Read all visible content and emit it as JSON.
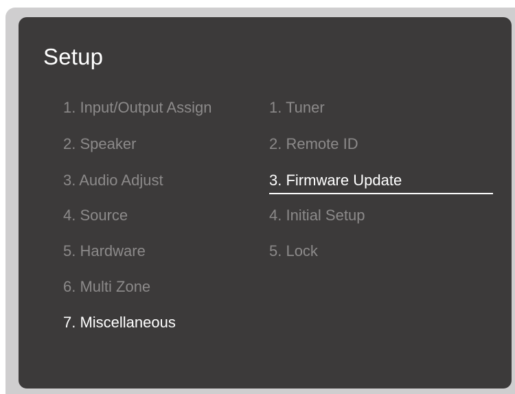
{
  "title": "Setup",
  "left_menu": [
    {
      "label": "1. Input/Output Assign",
      "selected": false
    },
    {
      "label": "2. Speaker",
      "selected": false
    },
    {
      "label": "3. Audio Adjust",
      "selected": false
    },
    {
      "label": "4. Source",
      "selected": false
    },
    {
      "label": "5. Hardware",
      "selected": false
    },
    {
      "label": "6. Multi Zone",
      "selected": false
    },
    {
      "label": "7. Miscellaneous",
      "selected": true
    }
  ],
  "right_menu": [
    {
      "label": "1. Tuner",
      "selected": false
    },
    {
      "label": "2. Remote ID",
      "selected": false
    },
    {
      "label": "3. Firmware Update",
      "selected": true
    },
    {
      "label": "4. Initial Setup",
      "selected": false
    },
    {
      "label": "5. Lock",
      "selected": false
    }
  ],
  "colors": {
    "panel_background": "#3c3a3a",
    "frame_background": "#cfcecf",
    "selected_text": "#ffffff",
    "unselected_text": "#8c8a8a"
  }
}
